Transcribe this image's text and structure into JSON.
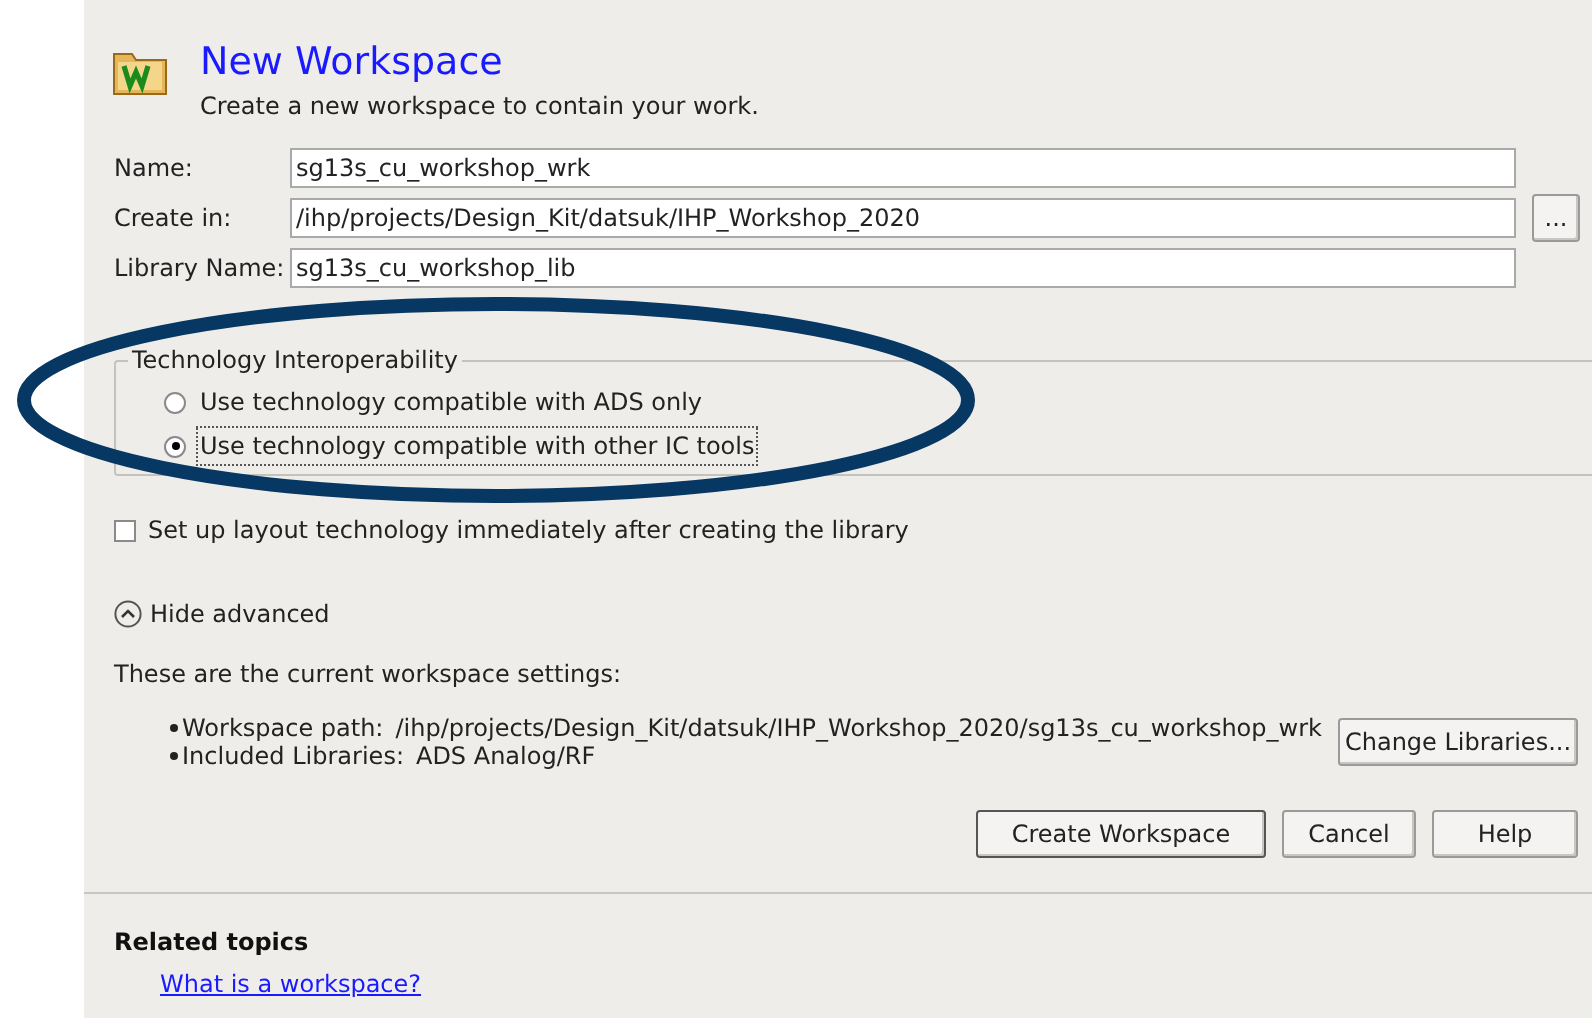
{
  "header": {
    "title": "New Workspace",
    "subtitle": "Create a new workspace to contain your work."
  },
  "fields": [
    {
      "label": "Name:",
      "value": "sg13s_cu_workshop_wrk"
    },
    {
      "label": "Create in:",
      "value": "/ihp/projects/Design_Kit/datsuk/IHP_Workshop_2020",
      "browse": "..."
    },
    {
      "label": "Library Name:",
      "value": "sg13s_cu_workshop_lib"
    }
  ],
  "technology_group": {
    "title": "Technology Interoperability",
    "options": [
      {
        "label": "Use technology compatible with ADS only",
        "selected": false
      },
      {
        "label": "Use technology compatible with other IC tools",
        "selected": true
      }
    ]
  },
  "setup_checkbox": {
    "label": "Set up layout technology immediately after creating the library",
    "checked": false
  },
  "advanced_toggle": {
    "label": "Hide advanced"
  },
  "settings": {
    "intro": "These are the current workspace settings:",
    "items": [
      {
        "label": "Workspace path:",
        "value": "/ihp/projects/Design_Kit/datsuk/IHP_Workshop_2020/sg13s_cu_workshop_wrk"
      },
      {
        "label": "Included Libraries:",
        "value": "ADS Analog/RF"
      }
    ],
    "button": "Change Libraries..."
  },
  "buttons": [
    "Create Workspace",
    "Cancel",
    "Help"
  ],
  "related": {
    "title": "Related topics",
    "link": "What is a workspace?"
  }
}
